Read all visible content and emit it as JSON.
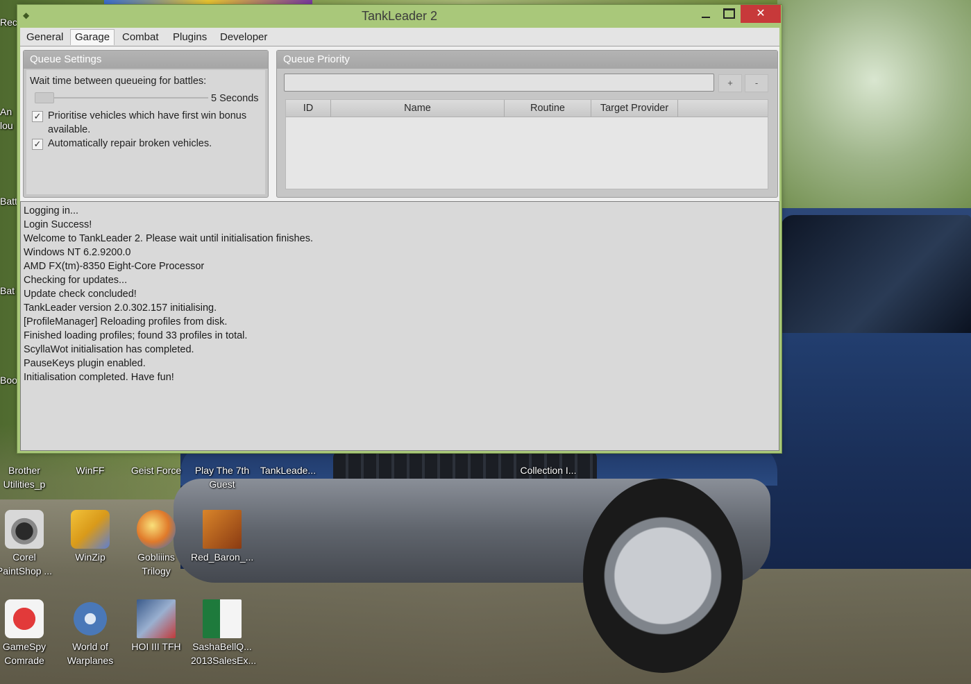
{
  "window": {
    "title": "TankLeader 2",
    "close_glyph": "✕"
  },
  "menu": {
    "tabs": [
      {
        "label": "General"
      },
      {
        "label": "Garage"
      },
      {
        "label": "Combat"
      },
      {
        "label": "Plugins"
      },
      {
        "label": "Developer"
      }
    ],
    "active_tab": "Garage"
  },
  "queue_settings": {
    "header": "Queue Settings",
    "wait_label": "Wait time between queueing for battles:",
    "wait_value": "5 Seconds",
    "wait_slider_fraction": 0.05,
    "first_win_checkbox": {
      "label_line1": "Prioritise vehicles which have first win bonus",
      "label_line2": "available.",
      "checked": true
    },
    "repair_checkbox": {
      "label": "Automatically repair broken vehicles.",
      "checked": true
    }
  },
  "queue_priority": {
    "header": "Queue Priority",
    "input_value": "",
    "add_label": "+",
    "remove_label": "-",
    "columns": [
      "ID",
      "Name",
      "Routine",
      "Target Provider"
    ],
    "rows": []
  },
  "log": {
    "lines": [
      "Logging in...",
      "Login Success!",
      "Welcome to TankLeader 2. Please wait until initialisation finishes.",
      "Windows NT 6.2.9200.0",
      "AMD FX(tm)-8350 Eight-Core Processor",
      "Checking for updates...",
      "Update check concluded!",
      "TankLeader version 2.0.302.157 initialising.",
      "[ProfileManager] Reloading profiles from disk.",
      "Finished loading profiles; found 33 profiles in total.",
      "ScyllaWot initialisation has completed.",
      "PauseKeys plugin enabled.",
      "Initialisation completed. Have fun!"
    ]
  },
  "desktop": {
    "left_partial_labels": [
      "Recy",
      "An",
      "lou",
      "Batt",
      "Bat",
      "Bool"
    ],
    "icons_row1": [
      {
        "label1": "Brother",
        "label2": "Utilities_p",
        "icon": "brother-icon"
      },
      {
        "label1": "WinFF",
        "label2": "",
        "icon": "winff-icon"
      },
      {
        "label1": "Geist Force",
        "label2": "",
        "icon": "geist-force-icon"
      },
      {
        "label1": "Play The 7th",
        "label2": "Guest",
        "icon": "play-7th-guest-icon"
      },
      {
        "label1": "TankLeade...",
        "label2": "",
        "icon": "tankleader-icon"
      },
      {
        "label1": "Collection I...",
        "label2": "",
        "icon": "collection-icon"
      }
    ],
    "icons_row2": [
      {
        "label1": "Corel",
        "label2": "PaintShop ...",
        "icon": "camera-icon"
      },
      {
        "label1": "WinZip",
        "label2": "",
        "icon": "winzip-icon"
      },
      {
        "label1": "Gobliiins",
        "label2": "Trilogy",
        "icon": "gobliiins-icon"
      },
      {
        "label1": "Red_Baron_...",
        "label2": "",
        "icon": "red-baron-icon"
      }
    ],
    "icons_row3": [
      {
        "label1": "GameSpy",
        "label2": "Comrade",
        "icon": "gamespy-icon"
      },
      {
        "label1": "World of",
        "label2": "Warplanes",
        "icon": "world-of-warplanes-icon"
      },
      {
        "label1": "HOI III TFH",
        "label2": "",
        "icon": "hoi3-icon"
      },
      {
        "label1": "SashaBellQ...",
        "label2": "2013SalesEx...",
        "icon": "excel-icon"
      }
    ],
    "colors": {
      "title_bar": "#a9c87a",
      "close_button": "#c7393a"
    }
  }
}
